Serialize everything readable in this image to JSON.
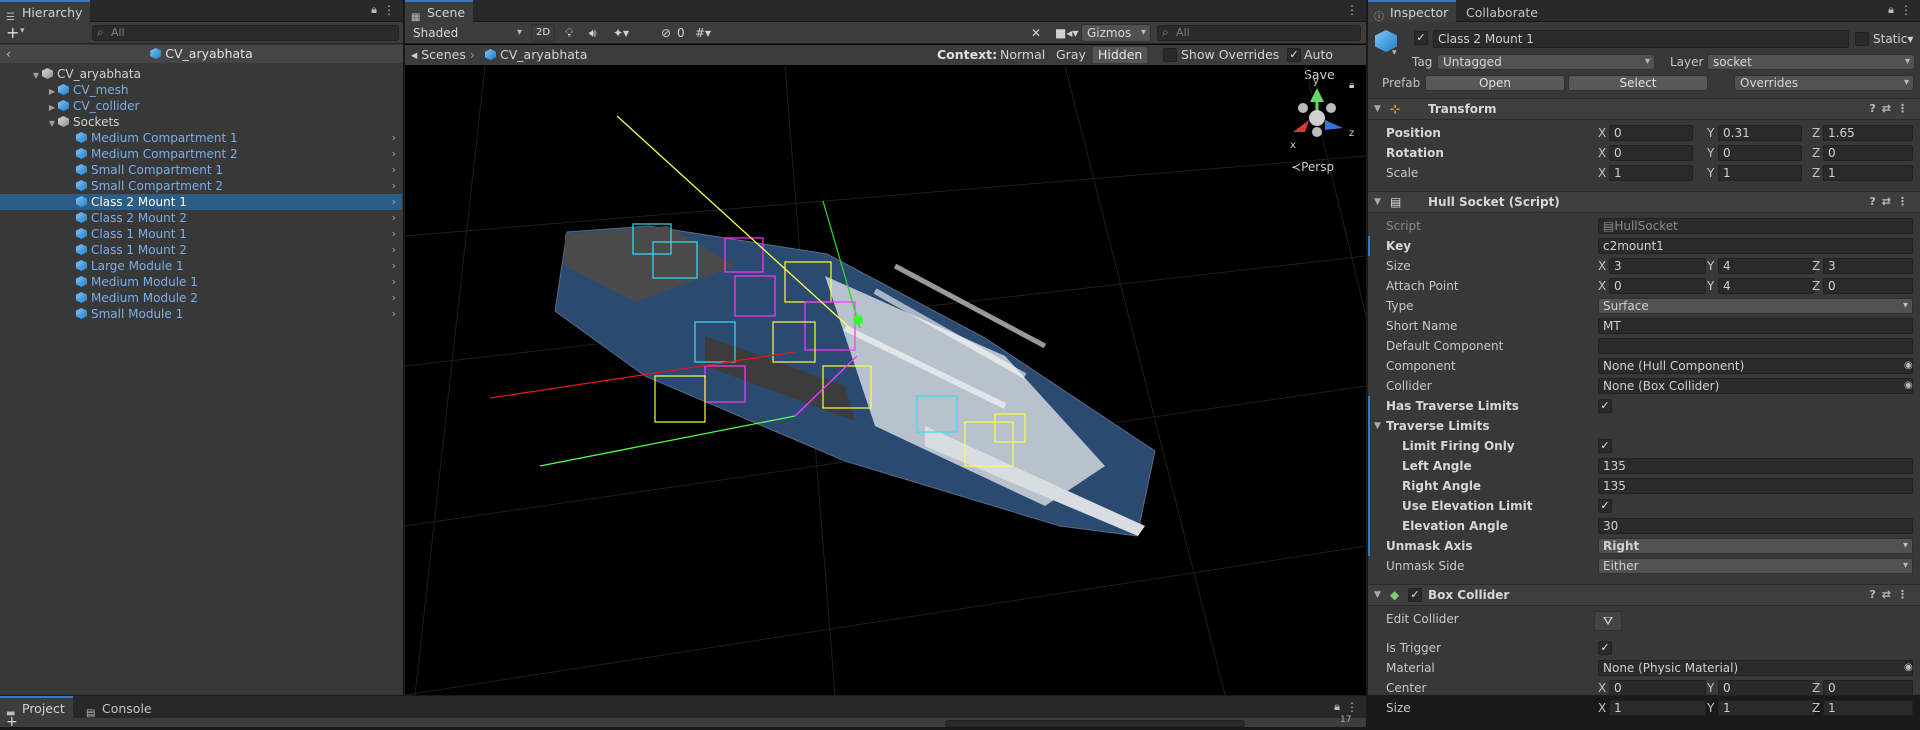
{
  "hierarchy": {
    "tab": "Hierarchy",
    "search_placeholder": "All",
    "scene_name": "CV_aryabhata",
    "root": "CV_aryabhata",
    "children": [
      "CV_mesh",
      "CV_collider",
      "Sockets"
    ],
    "sockets": [
      "Medium Compartment 1",
      "Medium Compartment 2",
      "Small Compartment 1",
      "Small Compartment 2",
      "Class 2 Mount 1",
      "Class 2 Mount 2",
      "Class 1 Mount 1",
      "Class 1 Mount 2",
      "Large Module 1",
      "Medium Module 1",
      "Medium Module 2",
      "Small Module 1"
    ],
    "selected_index": 4
  },
  "scene": {
    "tab": "Scene",
    "shading": "Shaded",
    "mode2d": "2D",
    "hidden_count": "0",
    "gizmos": "Gizmos",
    "search_placeholder": "All",
    "breadcrumb_root": "Scenes",
    "breadcrumb_item": "CV_aryabhata",
    "context_label": "Context:",
    "context_normal": "Normal",
    "context_gray": "Gray",
    "context_hidden": "Hidden",
    "show_overrides": "Show Overrides",
    "auto_save": "Auto Save",
    "persp": "Persp",
    "axes": {
      "x": "x",
      "y": "y",
      "z": "z"
    }
  },
  "inspector": {
    "tab": "Inspector",
    "tab2": "Collaborate",
    "object_name": "Class 2 Mount 1",
    "static": "Static",
    "tag_label": "Tag",
    "tag": "Untagged",
    "layer_label": "Layer",
    "layer": "socket",
    "prefab_label": "Prefab",
    "open": "Open",
    "select": "Select",
    "overrides": "Overrides",
    "transform": {
      "title": "Transform",
      "position": {
        "label": "Position",
        "x": "0",
        "y": "0.31",
        "z": "1.65"
      },
      "rotation": {
        "label": "Rotation",
        "x": "0",
        "y": "0",
        "z": "0"
      },
      "scale": {
        "label": "Scale",
        "x": "1",
        "y": "1",
        "z": "1"
      }
    },
    "hull": {
      "title": "Hull Socket (Script)",
      "script_label": "Script",
      "script": "HullSocket",
      "key_label": "Key",
      "key": "c2mount1",
      "size": {
        "label": "Size",
        "x": "3",
        "y": "4",
        "z": "3"
      },
      "attach": {
        "label": "Attach Point",
        "x": "0",
        "y": "4",
        "z": "0"
      },
      "type_label": "Type",
      "type": "Surface",
      "short_label": "Short Name",
      "short": "MT",
      "default_label": "Default Component",
      "component_label": "Component",
      "component": "None (Hull Component)",
      "collider_label": "Collider",
      "collider": "None (Box Collider)",
      "has_traverse": "Has Traverse Limits",
      "traverse": "Traverse Limits",
      "limit_firing": "Limit Firing Only",
      "left_label": "Left Angle",
      "left": "135",
      "right_label": "Right Angle",
      "right": "135",
      "use_elev": "Use Elevation Limit",
      "elev_label": "Elevation Angle",
      "elev": "30",
      "unmask_axis_label": "Unmask Axis",
      "unmask_axis": "Right",
      "unmask_side_label": "Unmask Side",
      "unmask_side": "Either"
    },
    "box": {
      "title": "Box Collider",
      "edit": "Edit Collider",
      "trigger": "Is Trigger",
      "material_label": "Material",
      "material": "None (Physic Material)",
      "center": {
        "label": "Center",
        "x": "0",
        "y": "0",
        "z": "0"
      },
      "size": {
        "label": "Size",
        "x": "1",
        "y": "1",
        "z": "1"
      }
    },
    "axis_x": "X",
    "axis_y": "Y",
    "axis_z": "Z"
  },
  "bottom": {
    "project": "Project",
    "console": "Console",
    "count": "17"
  },
  "colors": {
    "accent": "#3a79bb",
    "selection": "#2c5d87"
  }
}
